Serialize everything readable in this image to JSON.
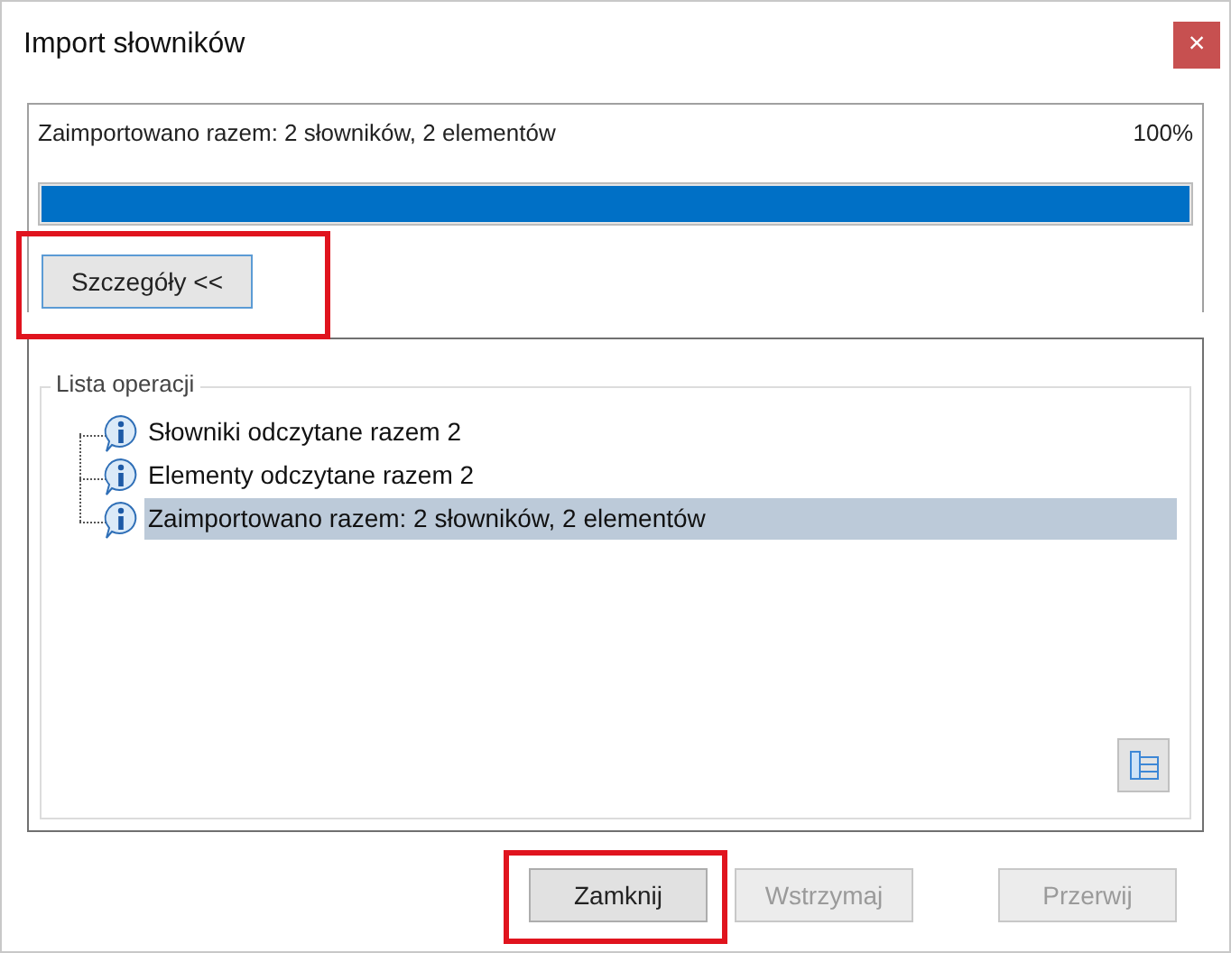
{
  "window": {
    "title": "Import słowników",
    "close": "×"
  },
  "progress": {
    "message": "Zaimportowano razem: 2 słowników, 2 elementów",
    "percent": "100%",
    "level": 1
  },
  "details_button": {
    "label": "Szczegóły <<",
    "highlighted": true
  },
  "operations": {
    "title": "Lista operacji",
    "items": [
      {
        "text": "Słowniki odczytane razem 2",
        "selected": false
      },
      {
        "text": "Elementy odczytane razem 2",
        "selected": false
      },
      {
        "text": "Zaimportowano razem: 2 słowników, 2 elementów",
        "selected": true
      }
    ]
  },
  "buttons": [
    {
      "label": "Zamknij",
      "disabled": false,
      "highlighted": true
    },
    {
      "label": "Wstrzymaj",
      "disabled": true,
      "highlighted": false
    },
    {
      "label": "Przerwij",
      "disabled": true,
      "highlighted": false
    }
  ]
}
